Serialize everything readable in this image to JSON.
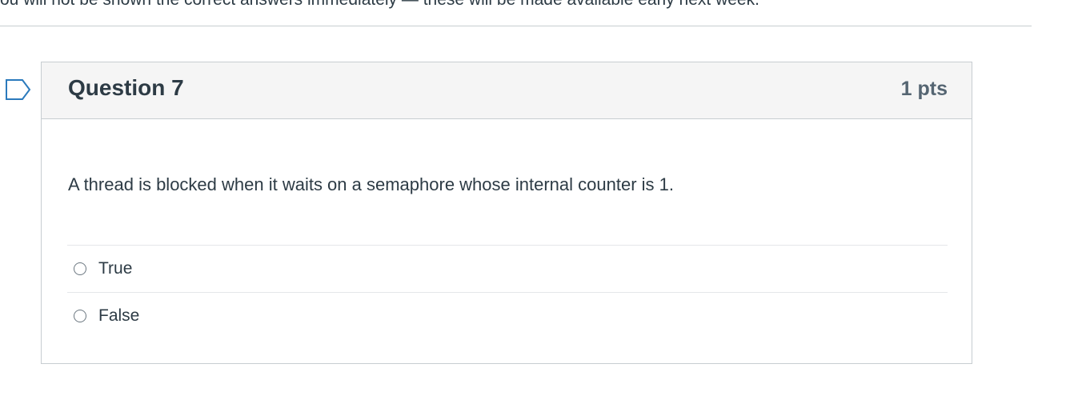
{
  "top_note": "ou will not be shown the correct answers immediately — these will be made available early next week.",
  "question": {
    "title": "Question 7",
    "points": "1 pts",
    "flag_icon": "flag-icon",
    "text": "A thread is blocked when it waits on a semaphore whose internal counter is 1.",
    "answers": [
      {
        "label": "True"
      },
      {
        "label": "False"
      }
    ]
  },
  "colors": {
    "header_bg": "#f5f5f5",
    "border": "#c7cdd1",
    "text": "#2d3b45",
    "points": "#556572"
  }
}
